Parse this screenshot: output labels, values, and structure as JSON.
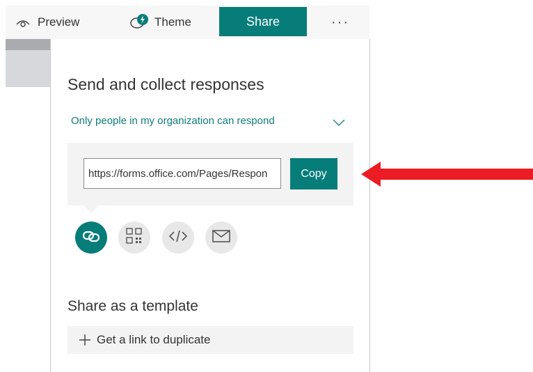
{
  "topbar": {
    "preview_label": "Preview",
    "theme_label": "Theme",
    "share_label": "Share",
    "more_label": "···"
  },
  "panel": {
    "title": "Send and collect responses",
    "scope_label": "Only people in my organization can respond",
    "link_value": "https://forms.office.com/Pages/Respon",
    "copy_label": "Copy",
    "share_options": [
      {
        "icon": "link-icon",
        "active": true
      },
      {
        "icon": "qr-code-icon",
        "active": false
      },
      {
        "icon": "embed-code-icon",
        "active": false
      },
      {
        "icon": "email-icon",
        "active": false
      }
    ],
    "template_title": "Share as a template",
    "duplicate_label": "Get a link to duplicate"
  },
  "colors": {
    "accent": "#077d7a",
    "arrow": "#ec1c24",
    "panel_bg": "#f3f3f3"
  }
}
